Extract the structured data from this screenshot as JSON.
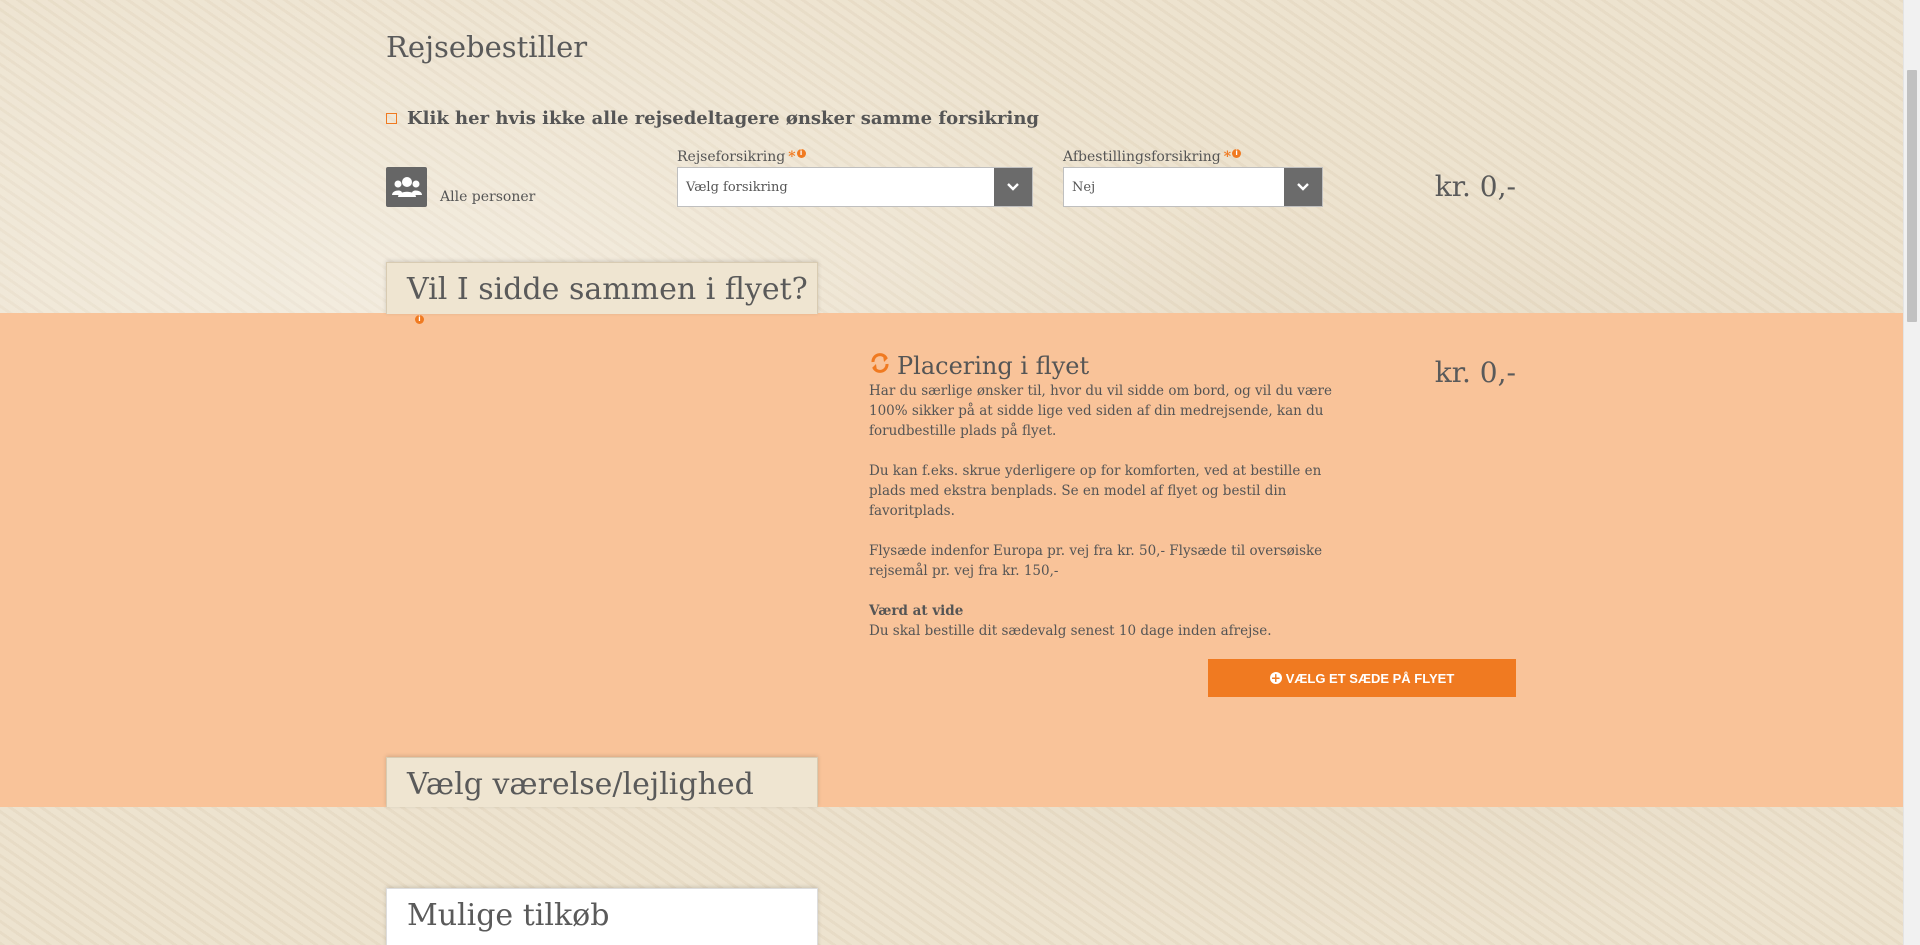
{
  "booker": {
    "title": "Rejsebestiller",
    "checkbox_label": "Klik her hvis ikke alle rejsedeltagere ønsker samme forsikring",
    "persons_label": "Alle personer",
    "travel_insurance": {
      "label": "Rejseforsikring",
      "required_mark": "*",
      "value": "Vælg forsikring"
    },
    "cancellation_insurance": {
      "label": "Afbestillingsforsikring",
      "required_mark": "*",
      "value": "Nej"
    },
    "price": "kr. 0,-"
  },
  "seating": {
    "tab_title": "Vil I sidde sammen i flyet?",
    "heading": "Placering i flyet",
    "price": "kr. 0,-",
    "paragraph1": "Har du særlige ønsker til, hvor du vil sidde om bord, og vil du være 100% sikker på at sidde lige ved siden af din medrejsende, kan du forudbestille plads på flyet.",
    "paragraph2": "Du kan f.eks. skrue yderligere op for komforten, ved at bestille en plads med ekstra benplads. Se en model af flyet og bestil din favoritplads.",
    "paragraph3": "Flysæde indenfor Europa pr. vej fra kr. 50,- Flysæde til oversøiske rejsemål pr. vej fra kr. 150,-",
    "know_title": "Værd at vide",
    "know_text": "Du skal bestille dit sædevalg senest 10 dage inden afrejse.",
    "cta_label": "VÆLG ET SÆDE PÅ FLYET"
  },
  "room": {
    "tab_title": "Vælg værelse/lejlighed"
  },
  "extras": {
    "tab_title": "Mulige tilkøb"
  },
  "icons": {
    "group": "users-icon",
    "caret": "chevron-down-icon",
    "sync": "sync-icon",
    "info": "info-icon",
    "plus": "plus-circle-icon"
  },
  "colors": {
    "accent": "#f07a21",
    "band": "#f9c399",
    "dark_button": "#6b6b6b"
  }
}
